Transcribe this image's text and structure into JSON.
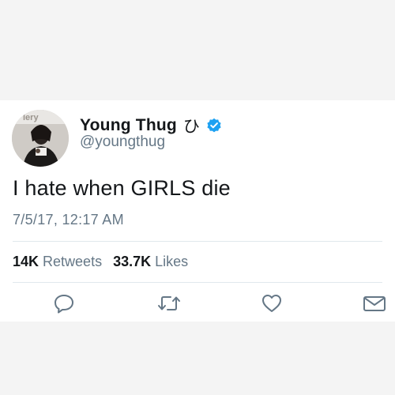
{
  "tweet": {
    "avatar_text": "lery",
    "display_name": "Young Thug",
    "name_symbol": "ひ",
    "handle": "@youngthug",
    "text": "I hate when GIRLS die",
    "timestamp": "7/5/17, 12:17 AM",
    "stats": {
      "retweets_count": "14K",
      "retweets_label": "Retweets",
      "likes_count": "33.7K",
      "likes_label": "Likes"
    }
  },
  "colors": {
    "verified": "#1da1f2",
    "text_primary": "#14171a",
    "text_secondary": "#657786",
    "divider": "#e1e8ed",
    "icon": "#657786"
  },
  "icons": [
    "verified-badge-icon",
    "reply-icon",
    "retweet-icon",
    "like-icon",
    "direct-message-icon"
  ]
}
